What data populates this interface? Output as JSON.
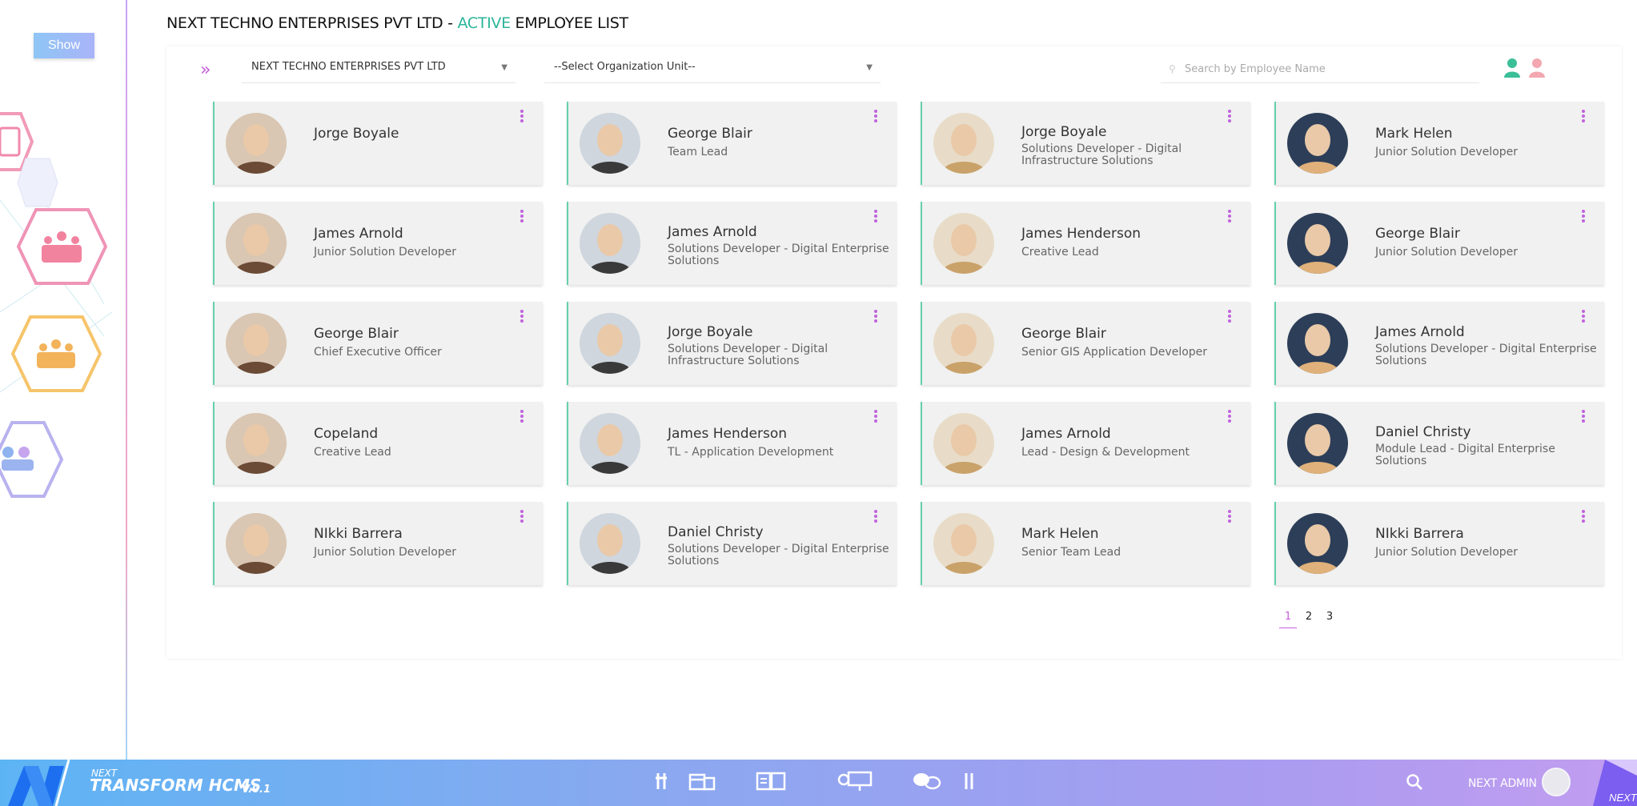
{
  "sidebar": {
    "show_label": "Show"
  },
  "header": {
    "company": "NEXT TECHNO ENTERPRISES PVT LTD",
    "separator": " - ",
    "active": "ACTIVE",
    "rest": " EMPLOYEE LIST"
  },
  "filters": {
    "company_value": "NEXT TECHNO ENTERPRISES PVT LTD",
    "org_value": "--Select Organization Unit--",
    "search_placeholder": "Search by Employee Name"
  },
  "employees": [
    {
      "name": "Jorge Boyale",
      "role": ""
    },
    {
      "name": "George Blair",
      "role": "Team Lead"
    },
    {
      "name": "Jorge Boyale",
      "role": "Solutions Developer - Digital Infrastructure Solutions"
    },
    {
      "name": "Mark Helen",
      "role": "Junior Solution Developer"
    },
    {
      "name": "James Arnold",
      "role": "Junior Solution Developer"
    },
    {
      "name": "James Arnold",
      "role": "Solutions Developer - Digital Enterprise Solutions"
    },
    {
      "name": "James Henderson",
      "role": "Creative Lead"
    },
    {
      "name": "George Blair",
      "role": "Junior Solution Developer"
    },
    {
      "name": "George Blair",
      "role": "Chief Executive Officer"
    },
    {
      "name": "Jorge Boyale",
      "role": "Solutions Developer - Digital Infrastructure Solutions"
    },
    {
      "name": "George Blair",
      "role": "Senior GIS Application Developer"
    },
    {
      "name": "James Arnold",
      "role": "Solutions Developer - Digital Enterprise Solutions"
    },
    {
      "name": "Copeland",
      "role": "Creative Lead"
    },
    {
      "name": "James Henderson",
      "role": "TL - Application Development"
    },
    {
      "name": "James Arnold",
      "role": "Lead - Design & Development"
    },
    {
      "name": "Daniel Christy",
      "role": "Module Lead - Digital Enterprise Solutions"
    },
    {
      "name": "NIkki Barrera",
      "role": "Junior Solution Developer"
    },
    {
      "name": "Daniel Christy",
      "role": "Solutions Developer - Digital Enterprise Solutions"
    },
    {
      "name": "Mark Helen",
      "role": "Senior Team Lead"
    },
    {
      "name": "NIkki Barrera",
      "role": "Junior Solution Developer"
    }
  ],
  "pagination": {
    "pages": [
      "1",
      "2",
      "3"
    ],
    "current": "1"
  },
  "footer": {
    "brand_small": "NEXT",
    "brand_title": "TRANSFORM HCMS",
    "version": "V.0.1",
    "admin": "NEXT ADMIN",
    "corner": "NEXT"
  },
  "colors": {
    "accent_green": "#2bb59a",
    "accent_purple": "#c45ed8",
    "card_border": "#66cfae"
  },
  "icons": [
    "expand-chevrons-icon",
    "search-icon",
    "active-employee-icon",
    "inactive-employee-icon",
    "kebab-menu-icon",
    "payroll-hex-icon",
    "team-hex-icon",
    "attendance-hex-icon",
    "employees-hex-icon"
  ]
}
